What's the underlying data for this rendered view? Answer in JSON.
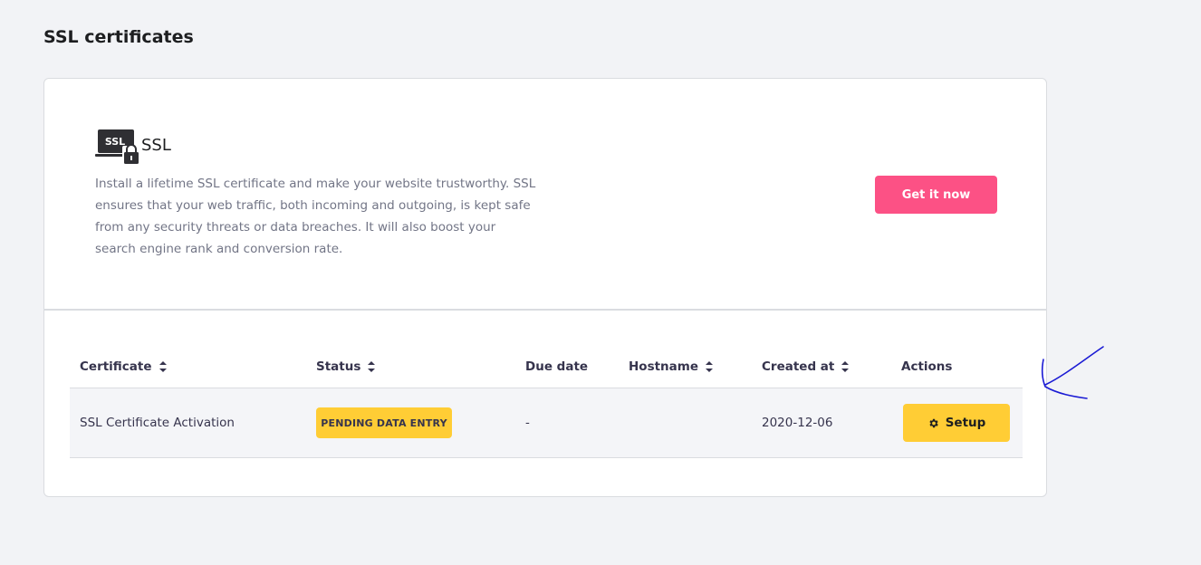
{
  "page": {
    "title": "SSL certificates"
  },
  "promo": {
    "logo_text": "SSL",
    "title": "SSL",
    "description": "Install a lifetime SSL certificate and make your website trustworthy. SSL ensures that your web traffic, both incoming and outgoing, is kept safe from any security threats or data breaches. It will also boost your search engine rank and conversion rate.",
    "cta_label": "Get it now"
  },
  "table": {
    "columns": {
      "certificate": "Certificate",
      "status": "Status",
      "due_date": "Due date",
      "hostname": "Hostname",
      "created_at": "Created at",
      "actions": "Actions"
    },
    "rows": [
      {
        "certificate": "SSL Certificate Activation",
        "status": "PENDING DATA ENTRY",
        "due_date": "-",
        "hostname": "",
        "created_at": "2020-12-06",
        "action_label": "Setup"
      }
    ]
  },
  "colors": {
    "accent_pink": "#fc5185",
    "status_yellow": "#ffcd35",
    "annotation_blue": "#1a1ad4"
  },
  "icons": [
    "ssl-laptop-lock-icon",
    "sort-icon",
    "gear-icon",
    "hand-drawn-arrow"
  ]
}
